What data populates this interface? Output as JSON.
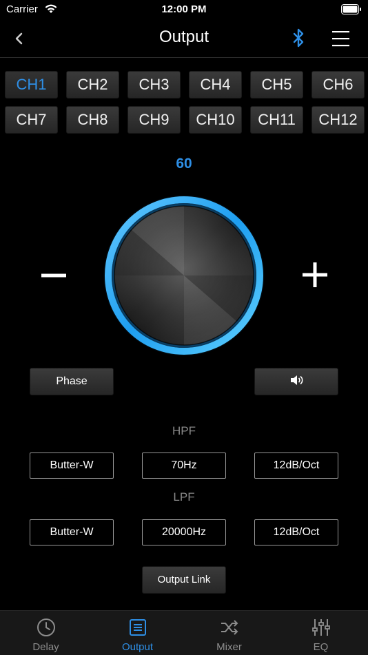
{
  "status_bar": {
    "carrier": "Carrier",
    "time": "12:00 PM"
  },
  "nav": {
    "title": "Output"
  },
  "channels": [
    "CH1",
    "CH2",
    "CH3",
    "CH4",
    "CH5",
    "CH6",
    "CH7",
    "CH8",
    "CH9",
    "CH10",
    "CH11",
    "CH12"
  ],
  "selected_channel": "CH1",
  "volume": {
    "value": "60",
    "minus_label": "−",
    "plus_label": "+"
  },
  "controls": {
    "phase_label": "Phase",
    "speaker_icon": "speaker-volume-icon"
  },
  "hpf": {
    "label": "HPF",
    "type": "Butter-W",
    "freq": "70Hz",
    "slope": "12dB/Oct"
  },
  "lpf": {
    "label": "LPF",
    "type": "Butter-W",
    "freq": "20000Hz",
    "slope": "12dB/Oct"
  },
  "output_link_label": "Output Link",
  "tabs": [
    {
      "label": "Delay",
      "icon": "clock-icon"
    },
    {
      "label": "Output",
      "icon": "list-icon"
    },
    {
      "label": "Mixer",
      "icon": "shuffle-icon"
    },
    {
      "label": "EQ",
      "icon": "sliders-icon"
    }
  ],
  "active_tab": "Output",
  "colors": {
    "accent": "#2e8fe6",
    "background": "#000000",
    "knob_ring": "#2aa8f5"
  }
}
